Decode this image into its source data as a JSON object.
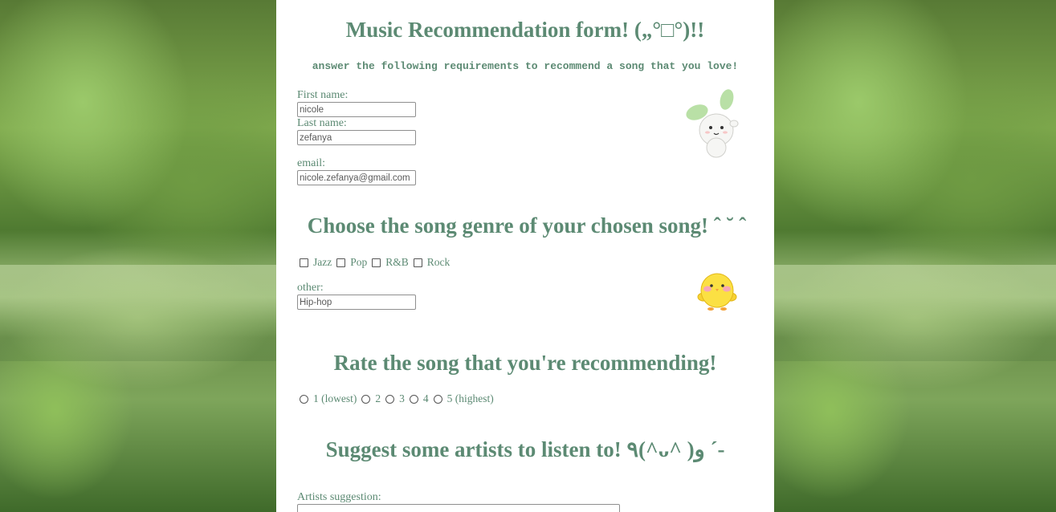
{
  "header": {
    "title": "Music Recommendation form! („°□°)!!",
    "subtitle": "answer the following requirements to recommend a song that you love!"
  },
  "personal": {
    "first_name_label": "First name:",
    "first_name_value": "nicole",
    "last_name_label": "Last name:",
    "last_name_value": "zefanya",
    "email_label": "email:",
    "email_value": "nicole.zefanya@gmail.com"
  },
  "genre": {
    "heading": "Choose the song genre of your chosen song! ˆ ˘ ˆ",
    "options": [
      "Jazz",
      "Pop",
      "R&B",
      "Rock"
    ],
    "other_label": "other:",
    "other_value": "Hip-hop"
  },
  "rating": {
    "heading": "Rate the song that you're recommending!",
    "options": [
      "1 (lowest)",
      "2",
      "3",
      "4",
      "5 (highest)"
    ]
  },
  "artists": {
    "heading": "Suggest some artists to listen to! ٩(^ᴗ^ )و ´-",
    "label": "Artists suggestion:"
  },
  "stickers": {
    "bunny": "bunny-sticker",
    "chick": "chick-sticker"
  },
  "colors": {
    "text": "#5c8a73",
    "panel": "#ffffff"
  }
}
